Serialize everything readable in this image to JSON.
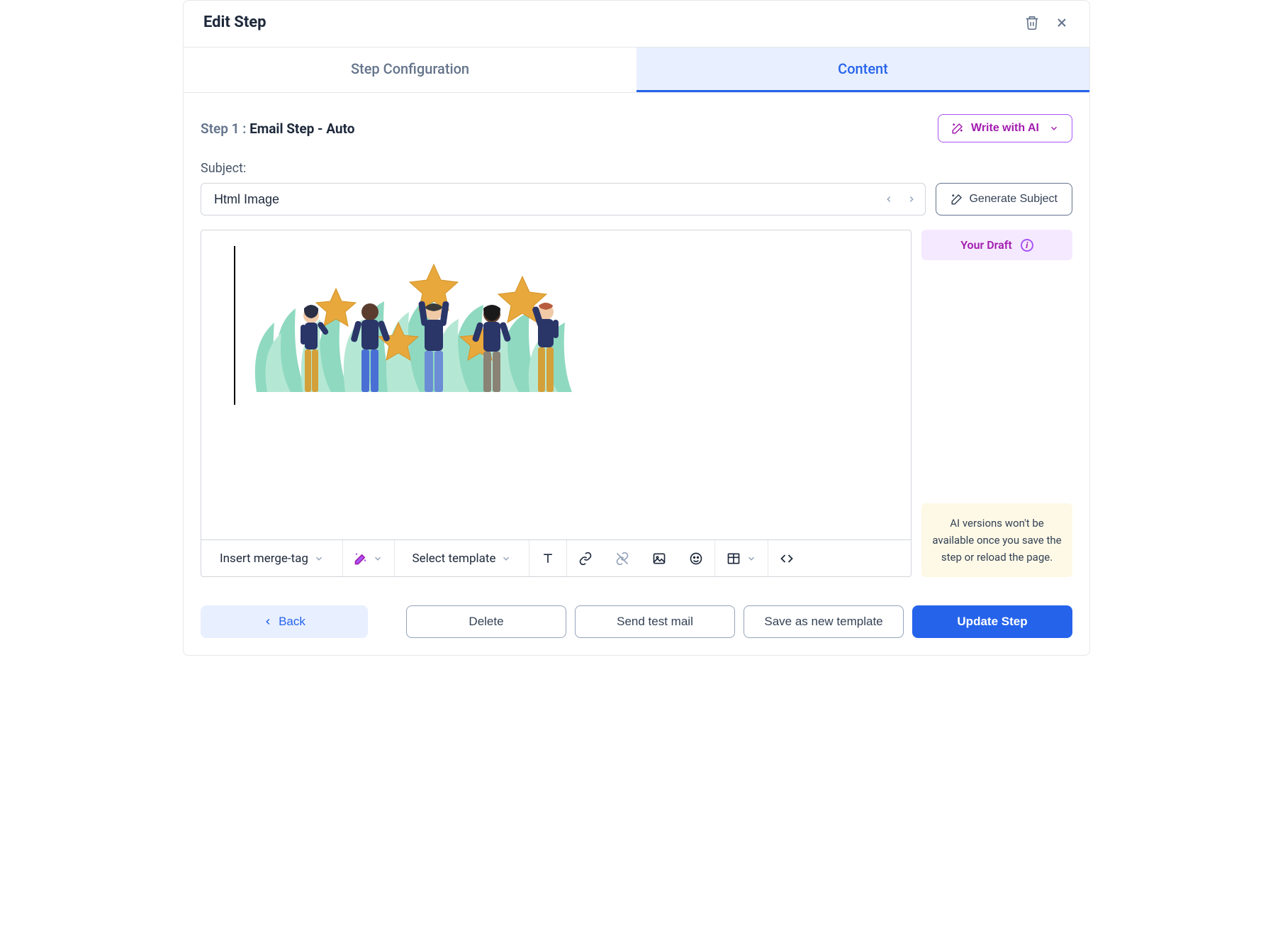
{
  "header": {
    "title": "Edit Step"
  },
  "tabs": {
    "config": "Step Configuration",
    "content": "Content"
  },
  "step": {
    "prefix": "Step 1 :",
    "name": "Email Step - Auto"
  },
  "ai_button": {
    "label": "Write with AI"
  },
  "subject": {
    "label": "Subject:",
    "value": "Html Image",
    "generate_label": "Generate Subject"
  },
  "draft": {
    "label": "Your Draft"
  },
  "toolbar": {
    "merge_tag": "Insert merge-tag",
    "select_template": "Select template"
  },
  "ai_notice": "AI versions won't be available once you save the step or reload the page.",
  "footer": {
    "back": "Back",
    "delete": "Delete",
    "send_test": "Send test mail",
    "save_template": "Save as new template",
    "update": "Update Step"
  }
}
